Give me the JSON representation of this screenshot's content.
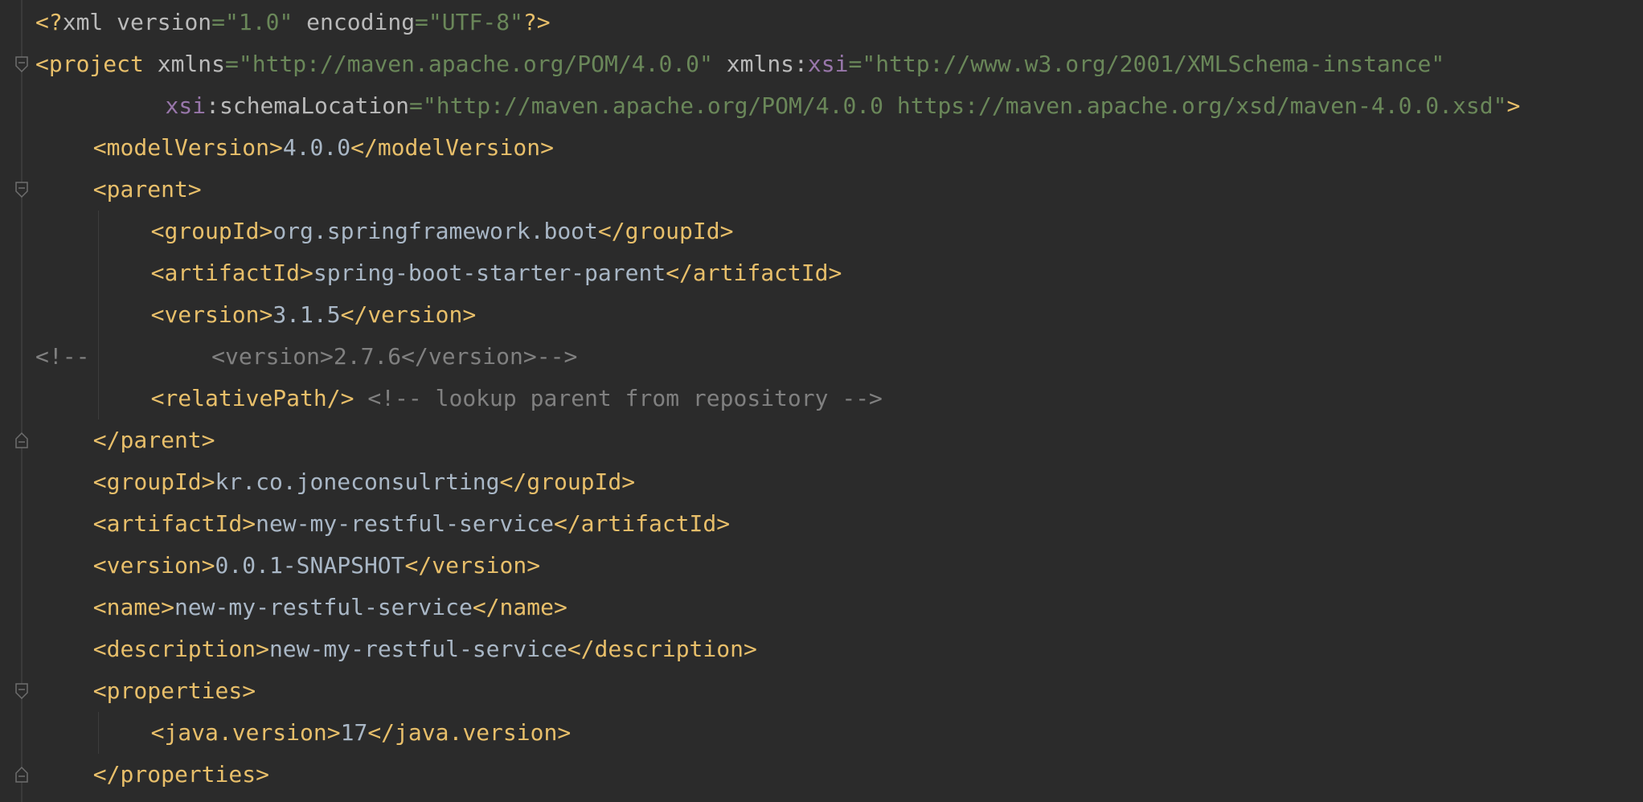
{
  "editor": {
    "lines": [
      {
        "indent": 0,
        "tokens": [
          {
            "t": "punc",
            "v": "<?"
          },
          {
            "t": "attr",
            "v": "xml "
          },
          {
            "t": "attr",
            "v": "version"
          },
          {
            "t": "str",
            "v": "=\"1.0\""
          },
          {
            "t": "attr",
            "v": " encoding"
          },
          {
            "t": "str",
            "v": "=\"UTF-8\""
          },
          {
            "t": "punc",
            "v": "?>"
          }
        ]
      },
      {
        "indent": 0,
        "fold": "open",
        "tokens": [
          {
            "t": "tag",
            "v": "<project"
          },
          {
            "t": "attr",
            "v": " xmlns"
          },
          {
            "t": "str",
            "v": "=\"http://maven.apache.org/POM/4.0.0\""
          },
          {
            "t": "attr",
            "v": " xmlns:"
          },
          {
            "t": "ns",
            "v": "xsi"
          },
          {
            "t": "str",
            "v": "=\"http://www.w3.org/2001/XMLSchema-instance\""
          }
        ]
      },
      {
        "indent": 9,
        "tokens": [
          {
            "t": "ns",
            "v": "xsi"
          },
          {
            "t": "attr",
            "v": ":schemaLocation"
          },
          {
            "t": "str",
            "v": "=\"http://maven.apache.org/POM/4.0.0 https://maven.apache.org/xsd/maven-4.0.0.xsd\""
          },
          {
            "t": "tag",
            "v": ">"
          }
        ]
      },
      {
        "indent": 4,
        "tokens": [
          {
            "t": "tag",
            "v": "<modelVersion>"
          },
          {
            "t": "text",
            "v": "4.0.0"
          },
          {
            "t": "tag",
            "v": "</modelVersion>"
          }
        ]
      },
      {
        "indent": 4,
        "fold": "open",
        "tokens": [
          {
            "t": "tag",
            "v": "<parent>"
          }
        ]
      },
      {
        "indent": 8,
        "tokens": [
          {
            "t": "tag",
            "v": "<groupId>"
          },
          {
            "t": "text",
            "v": "org.springframework.boot"
          },
          {
            "t": "tag",
            "v": "</groupId>"
          }
        ]
      },
      {
        "indent": 8,
        "tokens": [
          {
            "t": "tag",
            "v": "<artifactId>"
          },
          {
            "t": "text",
            "v": "spring-boot-starter-parent"
          },
          {
            "t": "tag",
            "v": "</artifactId>"
          }
        ]
      },
      {
        "indent": 8,
        "tokens": [
          {
            "t": "tag",
            "v": "<version>"
          },
          {
            "t": "text",
            "v": "3.1.5"
          },
          {
            "t": "tag",
            "v": "</version>"
          }
        ]
      },
      {
        "indent": 0,
        "tokens": [
          {
            "t": "comment",
            "v": "<!--         <version>2.7.6</version>-->"
          }
        ]
      },
      {
        "indent": 8,
        "tokens": [
          {
            "t": "tag",
            "v": "<relativePath/>"
          },
          {
            "t": "comment",
            "v": " <!-- lookup parent from repository -->"
          }
        ]
      },
      {
        "indent": 4,
        "fold": "close",
        "tokens": [
          {
            "t": "tag",
            "v": "</parent>"
          }
        ]
      },
      {
        "indent": 4,
        "tokens": [
          {
            "t": "tag",
            "v": "<groupId>"
          },
          {
            "t": "text",
            "v": "kr.co.joneconsulrting"
          },
          {
            "t": "tag",
            "v": "</groupId>"
          }
        ]
      },
      {
        "indent": 4,
        "tokens": [
          {
            "t": "tag",
            "v": "<artifactId>"
          },
          {
            "t": "text",
            "v": "new-my-restful-service"
          },
          {
            "t": "tag",
            "v": "</artifactId>"
          }
        ]
      },
      {
        "indent": 4,
        "tokens": [
          {
            "t": "tag",
            "v": "<version>"
          },
          {
            "t": "text",
            "v": "0.0.1-SNAPSHOT"
          },
          {
            "t": "tag",
            "v": "</version>"
          }
        ]
      },
      {
        "indent": 4,
        "tokens": [
          {
            "t": "tag",
            "v": "<name>"
          },
          {
            "t": "text",
            "v": "new-my-restful-service"
          },
          {
            "t": "tag",
            "v": "</name>"
          }
        ]
      },
      {
        "indent": 4,
        "tokens": [
          {
            "t": "tag",
            "v": "<description>"
          },
          {
            "t": "text",
            "v": "new-my-restful-service"
          },
          {
            "t": "tag",
            "v": "</description>"
          }
        ]
      },
      {
        "indent": 4,
        "fold": "open",
        "tokens": [
          {
            "t": "tag",
            "v": "<properties>"
          }
        ]
      },
      {
        "indent": 8,
        "tokens": [
          {
            "t": "tag",
            "v": "<java.version>"
          },
          {
            "t": "text",
            "v": "17"
          },
          {
            "t": "tag",
            "v": "</java.version>"
          }
        ]
      },
      {
        "indent": 4,
        "fold": "close",
        "tokens": [
          {
            "t": "tag",
            "v": "</properties>"
          }
        ]
      }
    ]
  }
}
